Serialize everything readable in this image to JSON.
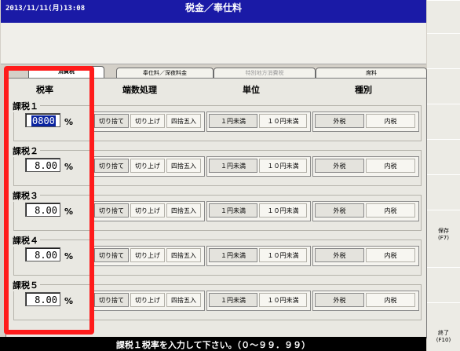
{
  "header": {
    "datetime": "2013/11/11(月)13:08",
    "title": "税金／奉仕料"
  },
  "tabs": [
    {
      "label": "消費税",
      "state": "active"
    },
    {
      "label": "奉仕料／深夜料金",
      "state": "normal"
    },
    {
      "label": "特別地方消費税",
      "state": "disabled"
    },
    {
      "label": "席料",
      "state": "normal"
    }
  ],
  "columns": {
    "rate": "税率",
    "rounding": "端数処理",
    "unit": "単位",
    "kind": "種別"
  },
  "rows": [
    {
      "label": "課税１",
      "rate": "0800",
      "pct": "%"
    },
    {
      "label": "課税２",
      "rate": "8.00",
      "pct": "%"
    },
    {
      "label": "課税３",
      "rate": "8.00",
      "pct": "%"
    },
    {
      "label": "課税４",
      "rate": "8.00",
      "pct": "%"
    },
    {
      "label": "課税５",
      "rate": "8.00",
      "pct": "%"
    }
  ],
  "options": {
    "rounding": [
      "切り捨て",
      "切り上げ",
      "四捨五入"
    ],
    "unit": [
      "１円未満",
      "１０円未満"
    ],
    "kind": [
      "外税",
      "内税"
    ]
  },
  "side_keys": {
    "save": "保存\n(F7)",
    "exit": "終了\n(F10)"
  },
  "status": "課税１税率を入力して下さい。（０～９９．９９）",
  "colors": {
    "title_bar": "#1a1aa6",
    "highlight": "#0a24a0",
    "annotation": "#ff1b1b"
  }
}
